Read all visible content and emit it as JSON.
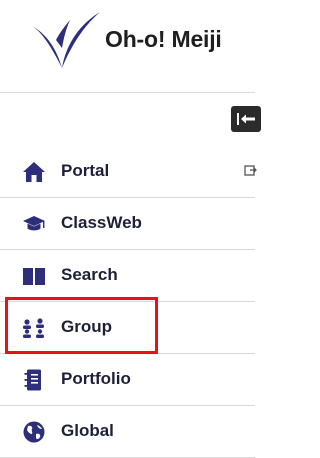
{
  "header": {
    "brand": "Oh-o! Meiji",
    "logo_color": "#2d2f7a"
  },
  "sidebar": {
    "collapse_icon": "collapse-left-icon",
    "items": [
      {
        "label": "Portal",
        "icon": "home-icon",
        "trailing_icon": "external-link-icon"
      },
      {
        "label": "ClassWeb",
        "icon": "graduation-cap-icon"
      },
      {
        "label": "Search",
        "icon": "book-icon"
      },
      {
        "label": "Group",
        "icon": "group-icon",
        "highlighted": true
      },
      {
        "label": "Portfolio",
        "icon": "notebook-icon"
      },
      {
        "label": "Global",
        "icon": "globe-icon"
      }
    ]
  },
  "colors": {
    "icon": "#2d2f7a",
    "text": "#1e2038",
    "divider": "#d9d9d9",
    "highlight": "#e8101a"
  }
}
